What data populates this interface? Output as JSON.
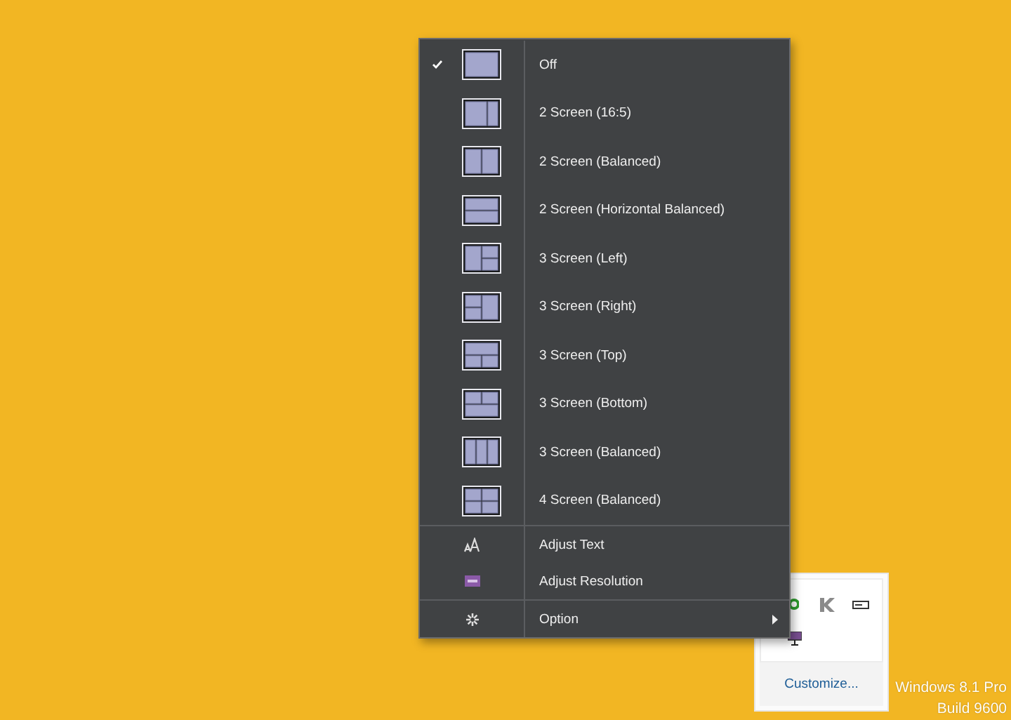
{
  "menu": {
    "layouts": [
      {
        "label": "Off",
        "kind": "single",
        "checked": true
      },
      {
        "label": "2 Screen (16:5)",
        "kind": "wide",
        "checked": false
      },
      {
        "label": "2 Screen (Balanced)",
        "kind": "halves",
        "checked": false
      },
      {
        "label": "2 Screen (Horizontal Balanced)",
        "kind": "rows",
        "checked": false
      },
      {
        "label": "3 Screen (Left)",
        "kind": "left",
        "checked": false
      },
      {
        "label": "3 Screen (Right)",
        "kind": "right",
        "checked": false
      },
      {
        "label": "3 Screen (Top)",
        "kind": "top",
        "checked": false
      },
      {
        "label": "3 Screen (Bottom)",
        "kind": "bottom",
        "checked": false
      },
      {
        "label": "3 Screen (Balanced)",
        "kind": "columns",
        "checked": false
      },
      {
        "label": "4 Screen (Balanced)",
        "kind": "quad",
        "checked": false
      }
    ],
    "tools": [
      {
        "label": "Adjust Text",
        "kind": "text"
      },
      {
        "label": "Adjust Resolution",
        "kind": "resolution"
      }
    ],
    "option": {
      "label": "Option",
      "has_submenu": true
    }
  },
  "tray": {
    "customize": "Customize..."
  },
  "desktop": {
    "edition": "Windows 8.1 Pro",
    "build": "Build 9600"
  }
}
